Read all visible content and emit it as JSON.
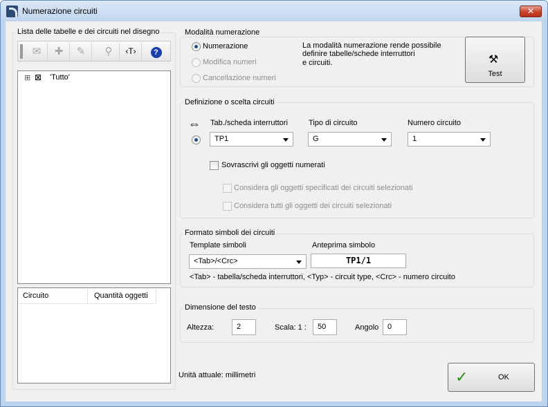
{
  "window": {
    "title": "Numerazione circuiti",
    "close_glyph": "✕"
  },
  "left": {
    "title": "Lista delle tabelle e dei circuiti nel disegno",
    "toolbar": [
      {
        "name": "delete-circuit-icon",
        "glyph": "✉"
      },
      {
        "name": "add-circuit-icon",
        "glyph": "✚"
      },
      {
        "name": "edit-circuit-icon",
        "glyph": "✎"
      },
      {
        "name": "find-circuit-icon",
        "glyph": "⚲"
      },
      {
        "name": "text-icon",
        "glyph": "‹T›"
      },
      {
        "name": "help-icon",
        "glyph": "?"
      }
    ],
    "tree": {
      "expander": "⊞",
      "node_icon": "⊠",
      "node_label": "'Tutto'"
    },
    "table": {
      "col_circuit": "Circuito",
      "col_quantity": "Quantità oggetti"
    }
  },
  "mode": {
    "title": "Modalità numerazione",
    "options": [
      "Numerazione",
      "Modifica numeri",
      "Cancellazione numeri"
    ],
    "selected_index": 0,
    "description": [
      "La modalità numerazione rende possibile",
      "definire tabelle/schede interruttori",
      "e circuiti."
    ],
    "test_label": "Test",
    "test_icon": "⚒"
  },
  "definition": {
    "title": "Definizione o scelta circuiti",
    "arrow_icon": "⇔",
    "tab_label": "Tab./scheda interruttori",
    "tab_value": "TP1",
    "type_label": "Tipo di circuito",
    "type_value": "G",
    "number_label": "Numero circuito",
    "number_value": "1",
    "overwrite_label": "Sovrascrivi gli oggetti numerati",
    "consider_selected_label": "Considera gli oggetti specificati dei circuiti selezionati",
    "consider_all_label": "Considera tutti gli oggetti dei circuiti selezionati"
  },
  "format": {
    "title": "Formato simboli dei circuiti",
    "template_label": "Template simboli",
    "template_value": "<Tab>/<Crc>",
    "preview_label": "Anteprima simbolo",
    "preview_value": "TP1/1",
    "legend": "<Tab> - tabella/scheda interruttori, <Typ> - circuit type, <Crc> - numero circuito"
  },
  "text_size": {
    "title": "Dimensione del testo",
    "height_label": "Altezza:",
    "height_value": "2",
    "scale_label": "Scala: 1 :",
    "scale_value": "50",
    "angle_label": "Angolo",
    "angle_value": "0"
  },
  "footer": {
    "units": "Unità attuale: millimetri",
    "ok_label": "OK",
    "ok_icon": "✓"
  },
  "colors": {
    "accent": "#1d4d8f",
    "ok_check": "#2e8b1f",
    "close": "#c8432a"
  }
}
